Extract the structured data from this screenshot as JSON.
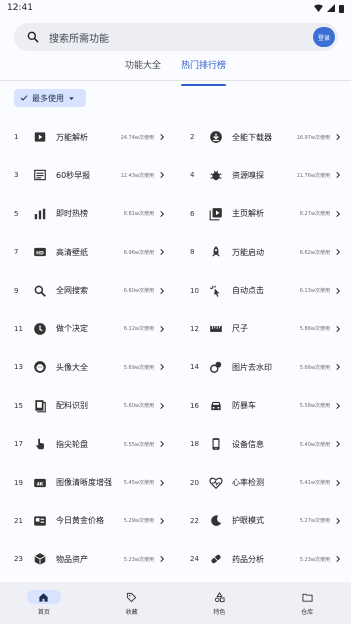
{
  "status": {
    "time": "12:41"
  },
  "search": {
    "placeholder": "搜索所需功能",
    "login_label": "登录"
  },
  "tabs": [
    {
      "label": "功能大全"
    },
    {
      "label": "热门排行榜"
    }
  ],
  "filter_chip": {
    "label": "最多使用"
  },
  "rankings": [
    {
      "rank": "1",
      "name": "万能解析",
      "uses": "24.74w次使用",
      "icon": "play-card-icon"
    },
    {
      "rank": "2",
      "name": "全能下载器",
      "uses": "16.97w次使用",
      "icon": "download-circle-icon"
    },
    {
      "rank": "3",
      "name": "60秒早报",
      "uses": "12.43w次使用",
      "icon": "newspaper-icon"
    },
    {
      "rank": "4",
      "name": "资源嗅探",
      "uses": "11.76w次使用",
      "icon": "bug-icon"
    },
    {
      "rank": "5",
      "name": "即时热榜",
      "uses": "8.81w次使用",
      "icon": "bar-chart-icon"
    },
    {
      "rank": "6",
      "name": "主页解析",
      "uses": "8.27w次使用",
      "icon": "video-library-icon"
    },
    {
      "rank": "7",
      "name": "高清壁纸",
      "uses": "6.96w次使用",
      "icon": "hd-icon"
    },
    {
      "rank": "8",
      "name": "万能启动",
      "uses": "6.62w次使用",
      "icon": "rocket-icon"
    },
    {
      "rank": "9",
      "name": "全网搜索",
      "uses": "6.60w次使用",
      "icon": "search-icon"
    },
    {
      "rank": "10",
      "name": "自动点击",
      "uses": "6.13w次使用",
      "icon": "tap-sparkle-icon"
    },
    {
      "rank": "11",
      "name": "做个决定",
      "uses": "6.12w次使用",
      "icon": "decision-circle-icon"
    },
    {
      "rank": "12",
      "name": "尺子",
      "uses": "5.86w次使用",
      "icon": "ruler-icon"
    },
    {
      "rank": "13",
      "name": "头像大全",
      "uses": "5.69w次使用",
      "icon": "avatar-face-icon"
    },
    {
      "rank": "14",
      "name": "图片去水印",
      "uses": "5.66w次使用",
      "icon": "watermark-remove-icon"
    },
    {
      "rank": "15",
      "name": "配料识别",
      "uses": "5.60w次使用",
      "icon": "ingredient-list-icon"
    },
    {
      "rank": "16",
      "name": "防暴车",
      "uses": "5.58w次使用",
      "icon": "car-icon"
    },
    {
      "rank": "17",
      "name": "指尖轮盘",
      "uses": "5.55w次使用",
      "icon": "finger-touch-icon"
    },
    {
      "rank": "18",
      "name": "设备信息",
      "uses": "5.40w次使用",
      "icon": "phone-info-icon"
    },
    {
      "rank": "19",
      "name": "图像清晰度增强",
      "uses": "5.45w次使用",
      "icon": "4k-icon"
    },
    {
      "rank": "20",
      "name": "心率检测",
      "uses": "5.41w次使用",
      "icon": "heart-pulse-icon"
    },
    {
      "rank": "21",
      "name": "今日黄金价格",
      "uses": "5.29w次使用",
      "icon": "price-tag-card-icon"
    },
    {
      "rank": "22",
      "name": "护眼模式",
      "uses": "5.27w次使用",
      "icon": "moon-eye-icon"
    },
    {
      "rank": "23",
      "name": "物品资产",
      "uses": "5.23w次使用",
      "icon": "box-icon"
    },
    {
      "rank": "24",
      "name": "药品分析",
      "uses": "5.23w次使用",
      "icon": "pill-icon"
    }
  ],
  "bottom_nav": [
    {
      "label": "首页",
      "icon": "home-icon"
    },
    {
      "label": "收藏",
      "icon": "tag-icon"
    },
    {
      "label": "特色",
      "icon": "shapes-icon"
    },
    {
      "label": "仓库",
      "icon": "folder-icon"
    }
  ]
}
